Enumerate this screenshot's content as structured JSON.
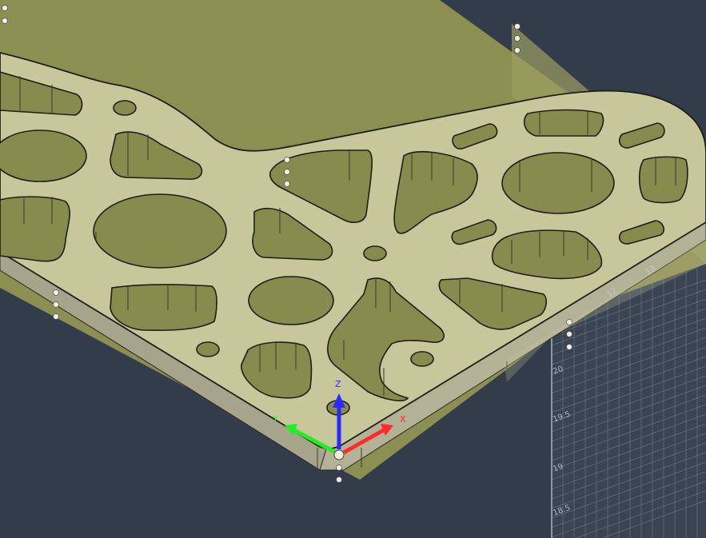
{
  "viewport": {
    "background": "#333c4b",
    "axes": {
      "x_label": "X",
      "y_label": "Y",
      "z_label": "Z",
      "x_color": "#ff2a2a",
      "y_color": "#22ee22",
      "z_color": "#2a2aff"
    },
    "ruler": {
      "ticks": [
        "20",
        "19.5",
        "19",
        "18.5"
      ],
      "top_ticks": [
        "12",
        "13"
      ]
    },
    "colors": {
      "stock_top": "#878b4d",
      "part_top": "#c8c79c",
      "part_side": "#a9a890",
      "pocket_floor": "#878b4d",
      "outline": "#1e1e14"
    }
  }
}
